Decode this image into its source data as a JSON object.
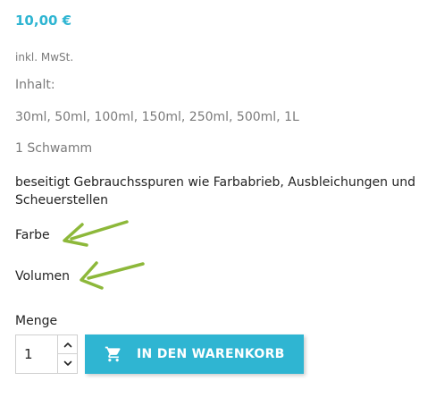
{
  "product": {
    "price": "10,00 €",
    "tax_note": "inkl. MwSt.",
    "content_label": "Inhalt:",
    "sizes": "30ml, 50ml, 100ml, 150ml, 250ml, 500ml, 1L",
    "sponge": "1 Schwamm",
    "description": "beseitigt Gebrauchsspuren wie Farbabrieb, Ausbleichungen und Scheuerstellen"
  },
  "variants": {
    "color_label": "Farbe",
    "volume_label": "Volumen"
  },
  "annotations": {
    "arrow_color": "#8db83a"
  },
  "quantity": {
    "label": "Menge",
    "value": "1"
  },
  "cart": {
    "button_label": "IN DEN WARENKORB",
    "icon": "shopping-cart-icon",
    "color": "#2fb5d2"
  },
  "colors": {
    "accent": "#2fb5d2",
    "text": "#232323",
    "muted": "#7a7a7a"
  }
}
